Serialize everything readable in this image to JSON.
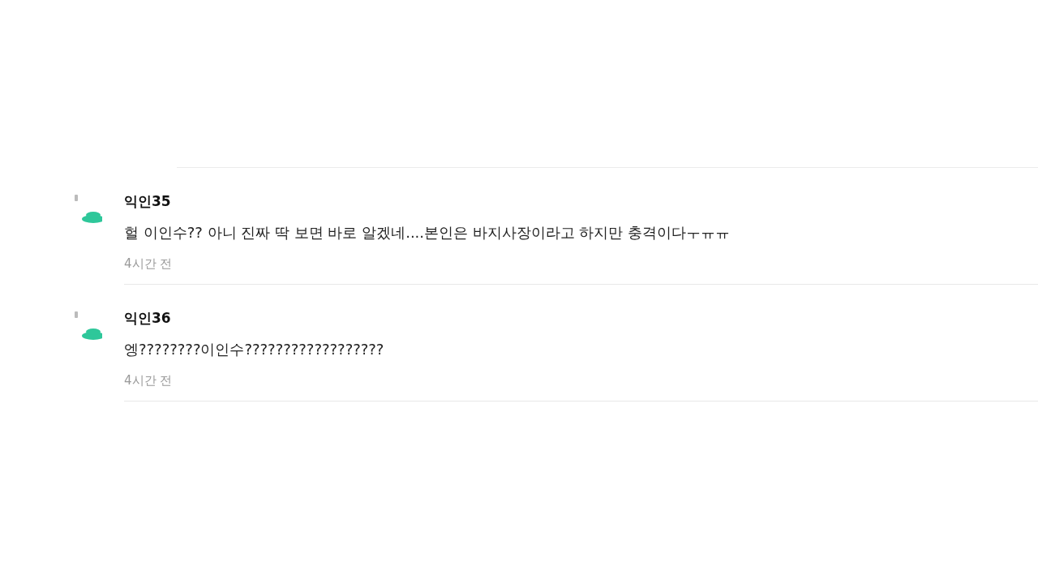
{
  "comments": [
    {
      "author": "익인35",
      "text": "헐 이인수?? 아니 진짜 딱 보면 바로 알겠네....본인은 바지사장이라고 하지만 충격이다ㅜㅠㅠ",
      "time": "4시간 전"
    },
    {
      "author": "익인36",
      "text": "엥????????이인수??????????????????",
      "time": "4시간 전"
    }
  ]
}
